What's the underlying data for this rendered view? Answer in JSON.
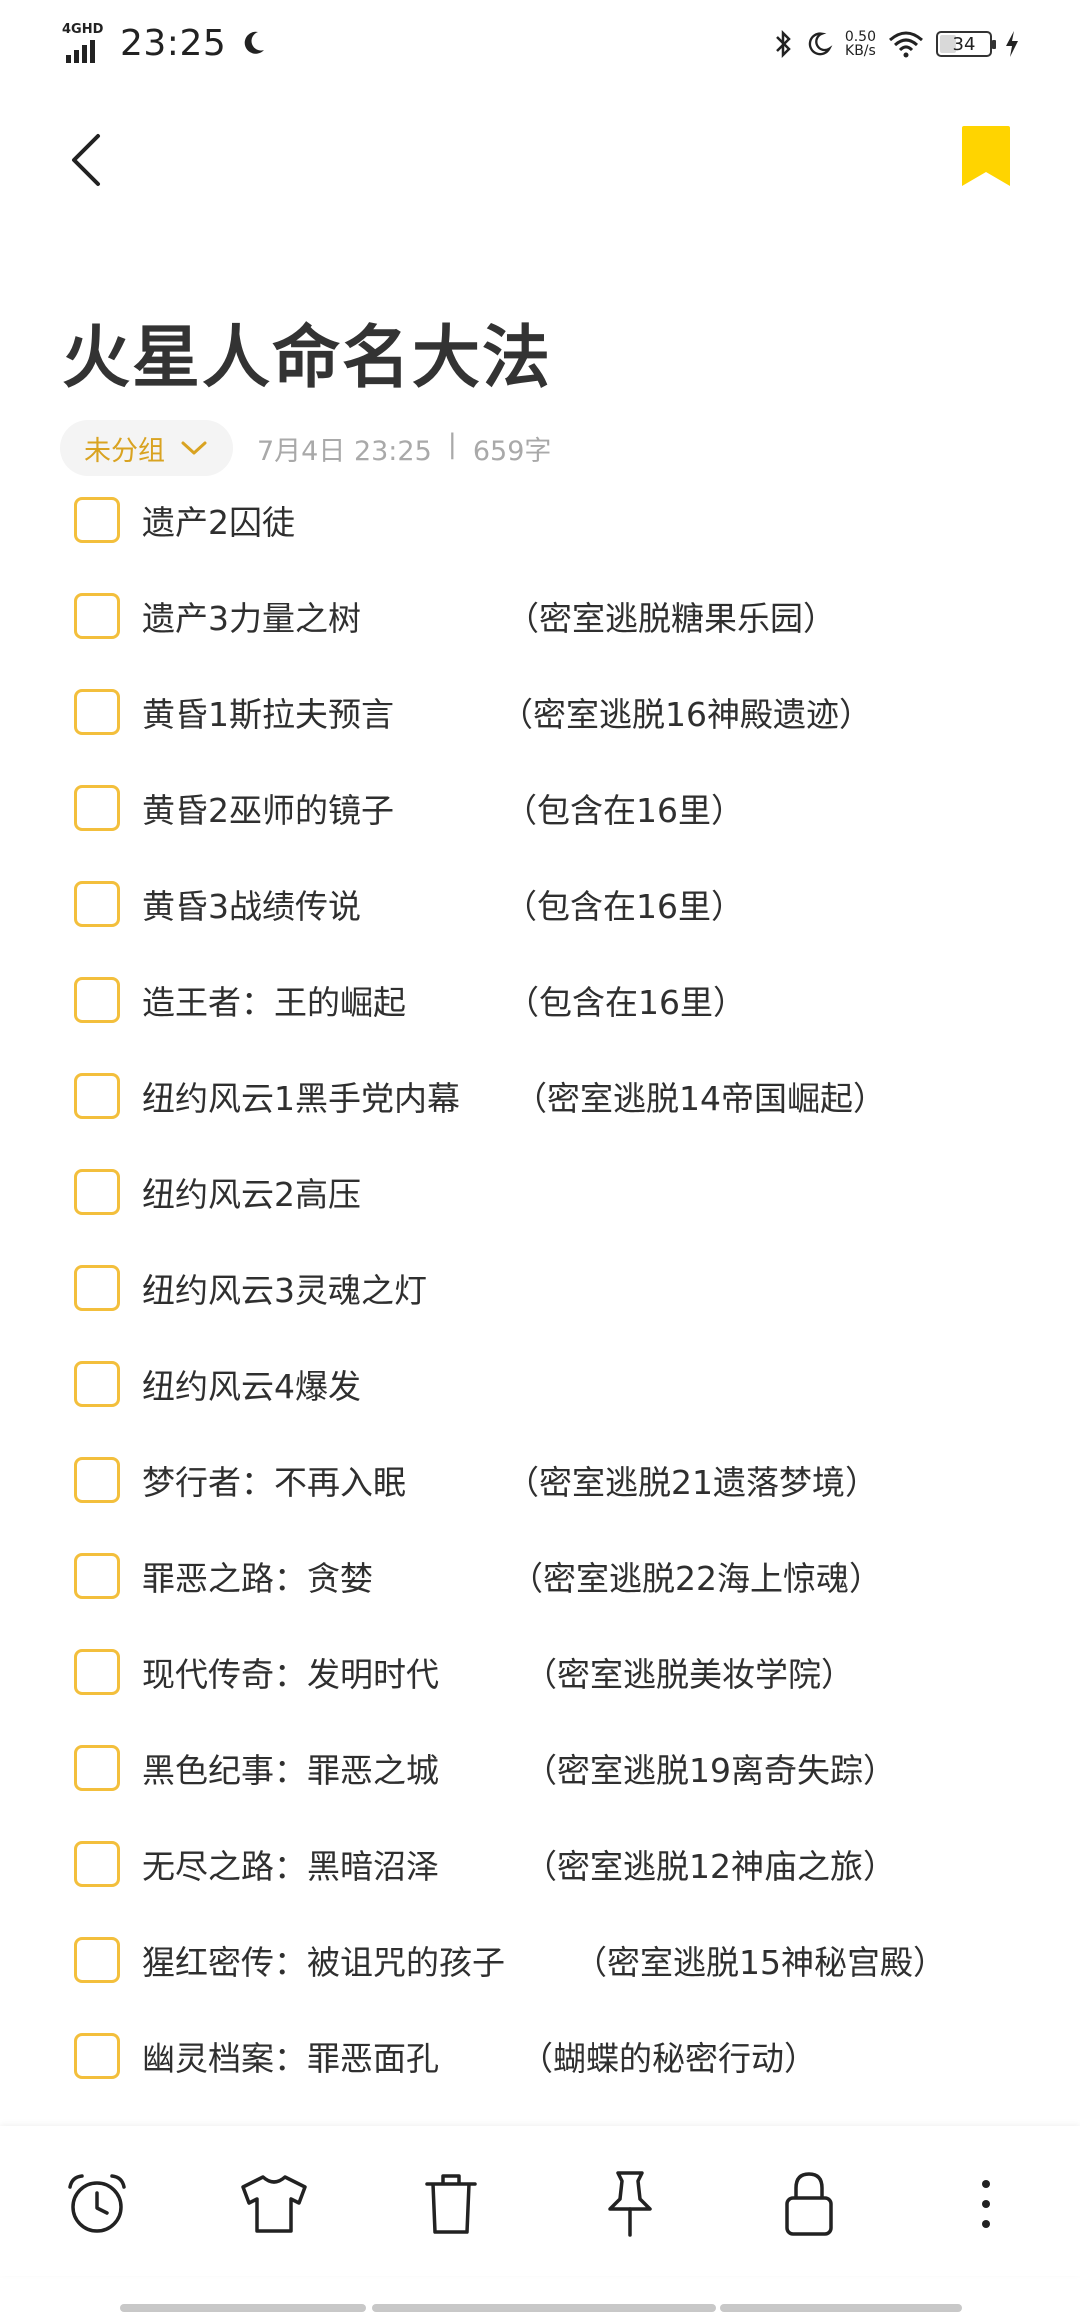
{
  "status_bar": {
    "network": "4GHD",
    "time": "23:25",
    "speed_value": "0.50",
    "speed_unit": "KB/s",
    "battery": "34"
  },
  "header": {
    "back_icon": "chevron-left-icon",
    "bookmark_icon": "bookmark-icon",
    "bookmark_color": "#ffd400"
  },
  "note": {
    "title": "火星人命名大法",
    "group": "未分组",
    "date": "7月4日 23:25",
    "separator": "|",
    "word_count": "659字",
    "accent_color": "#f3bf3c"
  },
  "items": [
    {
      "text": "遗产2囚徒",
      "note": ""
    },
    {
      "text": "遗产3力量之树",
      "note": "（密室逃脱糖果乐园）"
    },
    {
      "text": "黄昏1斯拉夫预言",
      "note": "（密室逃脱16神殿遗迹）"
    },
    {
      "text": "黄昏2巫师的镜子",
      "note": "（包含在16里）"
    },
    {
      "text": "黄昏3战绩传说",
      "note": "（包含在16里）"
    },
    {
      "text": "造王者：王的崛起",
      "note": "（包含在16里）"
    },
    {
      "text": "纽约风云1黑手党内幕",
      "note": "（密室逃脱14帝国崛起）"
    },
    {
      "text": "纽约风云2高压",
      "note": ""
    },
    {
      "text": "纽约风云3灵魂之灯",
      "note": ""
    },
    {
      "text": "纽约风云4爆发",
      "note": ""
    },
    {
      "text": "梦行者：不再入眠",
      "note": "（密室逃脱21遗落梦境）"
    },
    {
      "text": "罪恶之路：贪婪",
      "note": "（密室逃脱22海上惊魂）"
    },
    {
      "text": "现代传奇：发明时代",
      "note": "（密室逃脱美妆学院）"
    },
    {
      "text": "黑色纪事：罪恶之城",
      "note": "（密室逃脱19离奇失踪）"
    },
    {
      "text": "无尽之路：黑暗沼泽",
      "note": "（密室逃脱12神庙之旅）"
    },
    {
      "text": "猩红密传：被诅咒的孩子",
      "note": "（密室逃脱15神秘宫殿）"
    },
    {
      "text": "幽灵档案：罪恶面孔",
      "note": "（蝴蝶的秘密行动）"
    }
  ],
  "toolbar": {
    "icons": [
      "alarm-clock-icon",
      "shirt-icon",
      "trash-icon",
      "pin-icon",
      "lock-icon",
      "more-vertical-icon"
    ]
  }
}
